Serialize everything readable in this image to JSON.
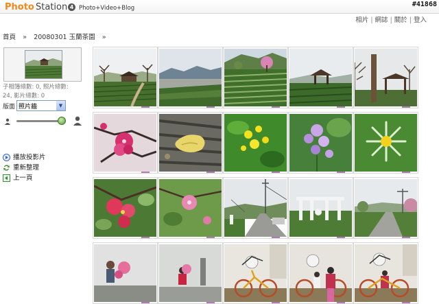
{
  "header": {
    "logo_photo": "Photo",
    "logo_station": "Station",
    "logo_version": "4",
    "tagline": "Photo+Video+Blog",
    "watermark": "#41868"
  },
  "topnav": {
    "items": [
      "相片",
      "網誌",
      "關於",
      "登入"
    ],
    "separator": "|"
  },
  "breadcrumb": {
    "items": [
      "首頁",
      "20080301 玉蘭茶園"
    ],
    "separator": "»"
  },
  "sidebar": {
    "counts_line1": "子相簿總數: 0, 照片總數:",
    "counts_line2": "24, 影片總數: 0",
    "layout_label": "版面",
    "layout_value": "照片牆",
    "actions": [
      {
        "label": "播放投影片",
        "icon": "play-icon"
      },
      {
        "label": "重新整理",
        "icon": "refresh-icon"
      },
      {
        "label": "上一頁",
        "icon": "back-icon"
      }
    ],
    "thumbnail_size_level": 0.92
  },
  "photos": [
    {
      "subject": "tea-garden-pavilion",
      "icon": "photo-thumbnail"
    },
    {
      "subject": "valley-view",
      "icon": "photo-thumbnail"
    },
    {
      "subject": "tea-rows-pink-tree",
      "icon": "photo-thumbnail"
    },
    {
      "subject": "gazebo-hill",
      "icon": "photo-thumbnail"
    },
    {
      "subject": "stone-pillar-pavilion",
      "icon": "photo-thumbnail"
    },
    {
      "subject": "cherry-blossom",
      "icon": "photo-thumbnail"
    },
    {
      "subject": "yellow-leaf-wood",
      "icon": "photo-thumbnail"
    },
    {
      "subject": "yellow-flowers",
      "icon": "photo-thumbnail"
    },
    {
      "subject": "purple-flower",
      "icon": "photo-thumbnail"
    },
    {
      "subject": "yellow-daisy",
      "icon": "photo-thumbnail"
    },
    {
      "subject": "red-blossom-leaves",
      "icon": "photo-thumbnail"
    },
    {
      "subject": "pink-blossom-branch",
      "icon": "photo-thumbnail"
    },
    {
      "subject": "road-statue",
      "icon": "photo-thumbnail"
    },
    {
      "subject": "white-gate",
      "icon": "photo-thumbnail"
    },
    {
      "subject": "country-road",
      "icon": "photo-thumbnail"
    },
    {
      "subject": "misty-people-1",
      "icon": "photo-thumbnail"
    },
    {
      "subject": "misty-people-2",
      "icon": "photo-thumbnail"
    },
    {
      "subject": "bicycle-sculpture-1",
      "icon": "photo-thumbnail"
    },
    {
      "subject": "bicycle-sculpture-2",
      "icon": "photo-thumbnail"
    },
    {
      "subject": "bicycle-sculpture-3",
      "icon": "photo-thumbnail"
    }
  ],
  "colors": {
    "logo_orange": "#f08a1b",
    "thumb_border": "#d9d9d9",
    "select_border": "#7f9db9",
    "slider_knob": "#5a9d3b"
  }
}
